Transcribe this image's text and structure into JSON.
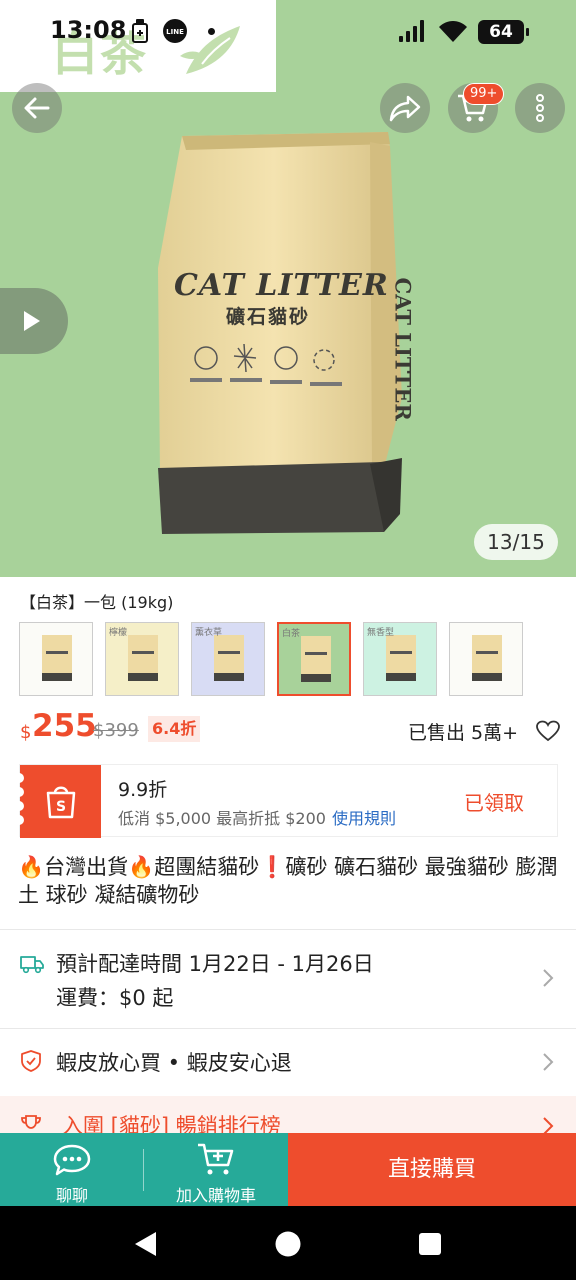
{
  "status_bar": {
    "time": "13:08",
    "battery": "64"
  },
  "watermark": {
    "text": "白茶"
  },
  "hero": {
    "counter": "13/15",
    "cart_badge": "99+",
    "bag_title": "CAT LITTER",
    "bag_subtitle": "礦石貓砂",
    "bag_side_text": "CAT LITTER"
  },
  "variant": {
    "selected_label": "【白茶】一包 (19kg)",
    "thumbs": [
      {
        "tag": ""
      },
      {
        "tag": "檸檬"
      },
      {
        "tag": "薰衣草"
      },
      {
        "tag": "白茶"
      },
      {
        "tag": "無香型"
      },
      {
        "tag": ""
      }
    ]
  },
  "price": {
    "currency": "$",
    "current": "255",
    "original": "$399",
    "discount": "6.4折",
    "sold": "已售出 5萬+"
  },
  "voucher": {
    "title": "9.9折",
    "subtitle": "低消 $5,000 最高折抵 $200",
    "rule_link": "使用規則",
    "claimed": "已領取"
  },
  "product": {
    "title": "🔥台灣出貨🔥超團結貓砂❗礦砂 礦石貓砂 最強貓砂 膨潤土 球砂 凝結礦物砂"
  },
  "delivery": {
    "line1": "預計配達時間 1月22日 - 1月26日",
    "line2": "運費：$0 起"
  },
  "guarantee": {
    "text": "蝦皮放心買 • 蝦皮安心退"
  },
  "ranking": {
    "text": "入圍 [貓砂] 暢銷排行榜"
  },
  "bottom_bar": {
    "chat": "聊聊",
    "add_cart": "加入購物車",
    "buy_now": "直接購買"
  },
  "colors": {
    "accent": "#ee4d2d",
    "teal": "#26aa99",
    "hero_bg": "#a8d29a"
  }
}
